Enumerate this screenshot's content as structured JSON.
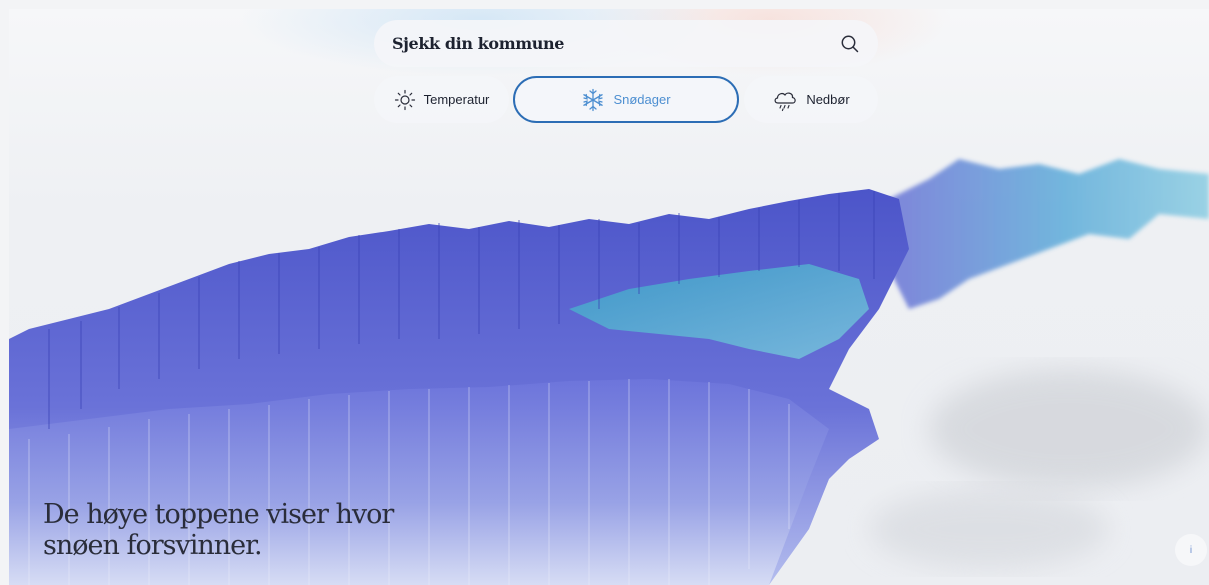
{
  "search": {
    "label": "Sjekk din kommune",
    "icon": "search-icon"
  },
  "tabs": [
    {
      "label": "Temperatur",
      "icon": "sun-icon",
      "active": false
    },
    {
      "label": "Snødager",
      "icon": "snowflake-icon",
      "active": true
    },
    {
      "label": "Nedbør",
      "icon": "rain-cloud-icon",
      "active": false
    }
  ],
  "caption": {
    "line1": "De høye toppene viser hvor",
    "line2": "snøen forsvinner."
  },
  "info_button": {
    "label": "i"
  },
  "colors": {
    "accent": "#2c6db5",
    "terrain_dark": "#4a55c8",
    "terrain_mid": "#6e74dc",
    "terrain_light": "#a9b4ea",
    "terrain_cyan": "#3fb5cf"
  }
}
